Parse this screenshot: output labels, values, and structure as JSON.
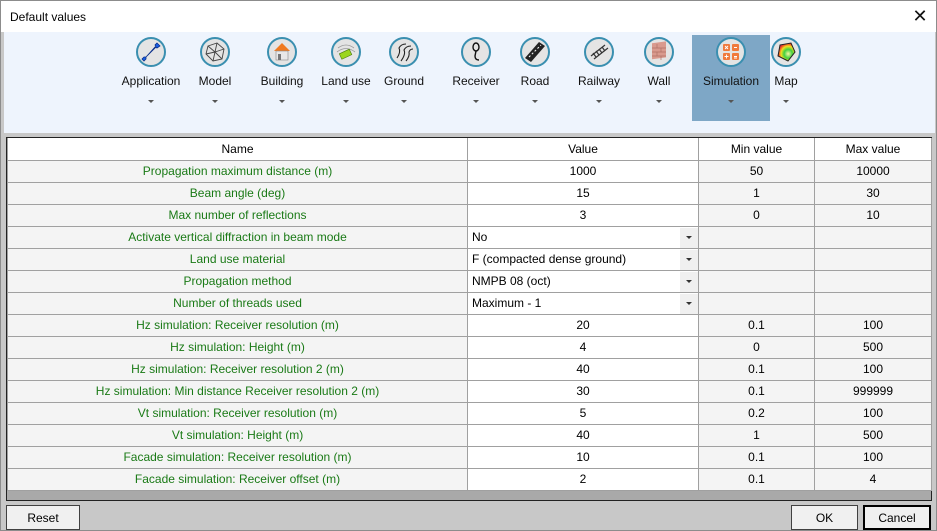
{
  "window": {
    "title": "Default values",
    "close_icon": "close-icon"
  },
  "ribbon": {
    "active": "Simulation",
    "items": [
      {
        "label": "Application",
        "icon": "wrench-icon"
      },
      {
        "label": "Model",
        "icon": "mesh-icon"
      },
      {
        "label": "Building",
        "icon": "house-icon"
      },
      {
        "label": "Land use",
        "icon": "land-use-icon"
      },
      {
        "label": "Ground",
        "icon": "ground-icon"
      },
      {
        "label": "Receiver",
        "icon": "receiver-icon"
      },
      {
        "label": "Road",
        "icon": "road-icon"
      },
      {
        "label": "Railway",
        "icon": "railway-icon"
      },
      {
        "label": "Wall",
        "icon": "wall-icon"
      },
      {
        "label": "Simulation",
        "icon": "calculator-icon"
      },
      {
        "label": "Map",
        "icon": "map-icon"
      }
    ]
  },
  "grid": {
    "columns": [
      "Name",
      "Value",
      "Min value",
      "Max value"
    ],
    "rows": [
      {
        "name": "Propagation maximum distance (m)",
        "value": "1000",
        "min": "50",
        "max": "10000"
      },
      {
        "name": "Beam angle (deg)",
        "value": "15",
        "min": "1",
        "max": "30"
      },
      {
        "name": "Max number of reflections",
        "value": "3",
        "min": "0",
        "max": "10"
      },
      {
        "name": "Activate vertical diffraction in beam mode",
        "value": "No",
        "min": "",
        "max": "",
        "combo": true
      },
      {
        "name": "Land use material",
        "value": "F (compacted dense ground)",
        "min": "",
        "max": "",
        "combo": true
      },
      {
        "name": "Propagation method",
        "value": "NMPB 08 (oct)",
        "min": "",
        "max": "",
        "combo": true
      },
      {
        "name": "Number of threads used",
        "value": "Maximum - 1",
        "min": "",
        "max": "",
        "combo": true
      },
      {
        "name": "Hz simulation: Receiver resolution (m)",
        "value": "20",
        "min": "0.1",
        "max": "100"
      },
      {
        "name": "Hz simulation: Height (m)",
        "value": "4",
        "min": "0",
        "max": "500"
      },
      {
        "name": "Hz simulation: Receiver resolution 2 (m)",
        "value": "40",
        "min": "0.1",
        "max": "100"
      },
      {
        "name": "Hz simulation: Min distance Receiver resolution 2 (m)",
        "value": "30",
        "min": "0.1",
        "max": "999999"
      },
      {
        "name": "Vt simulation: Receiver resolution (m)",
        "value": "5",
        "min": "0.2",
        "max": "100"
      },
      {
        "name": "Vt simulation: Height (m)",
        "value": "40",
        "min": "1",
        "max": "500"
      },
      {
        "name": "Facade simulation: Receiver resolution (m)",
        "value": "10",
        "min": "0.1",
        "max": "100"
      },
      {
        "name": "Facade simulation: Receiver offset (m)",
        "value": "2",
        "min": "0.1",
        "max": "4"
      }
    ]
  },
  "buttons": {
    "reset": "Reset",
    "ok": "OK",
    "cancel": "Cancel"
  },
  "colors": {
    "name_text": "#1a7a16",
    "ribbon_active": "#7ea7c6",
    "ribbon_bg": "#eef4fd"
  }
}
